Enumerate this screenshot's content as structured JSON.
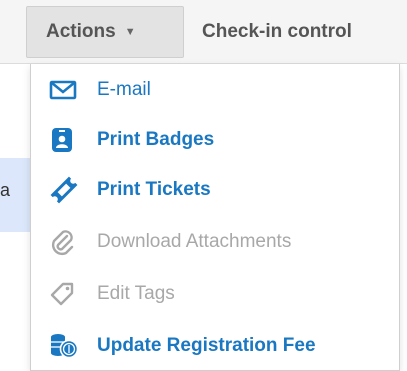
{
  "toolbar": {
    "actions_label": "Actions",
    "checkin_label": "Check-in control"
  },
  "background": {
    "letter": "a"
  },
  "menu": {
    "items": [
      {
        "label": "E-mail",
        "icon": "envelope-icon",
        "enabled": true
      },
      {
        "label": "Print Badges",
        "icon": "badge-icon",
        "enabled": true
      },
      {
        "label": "Print Tickets",
        "icon": "ticket-icon",
        "enabled": true
      },
      {
        "label": "Download Attachments",
        "icon": "paperclip-icon",
        "enabled": false
      },
      {
        "label": "Edit Tags",
        "icon": "tag-icon",
        "enabled": false
      },
      {
        "label": "Update Registration Fee",
        "icon": "coins-icon",
        "enabled": true
      }
    ]
  },
  "colors": {
    "accent": "#1a78c2",
    "disabled": "#a8a8a8"
  }
}
